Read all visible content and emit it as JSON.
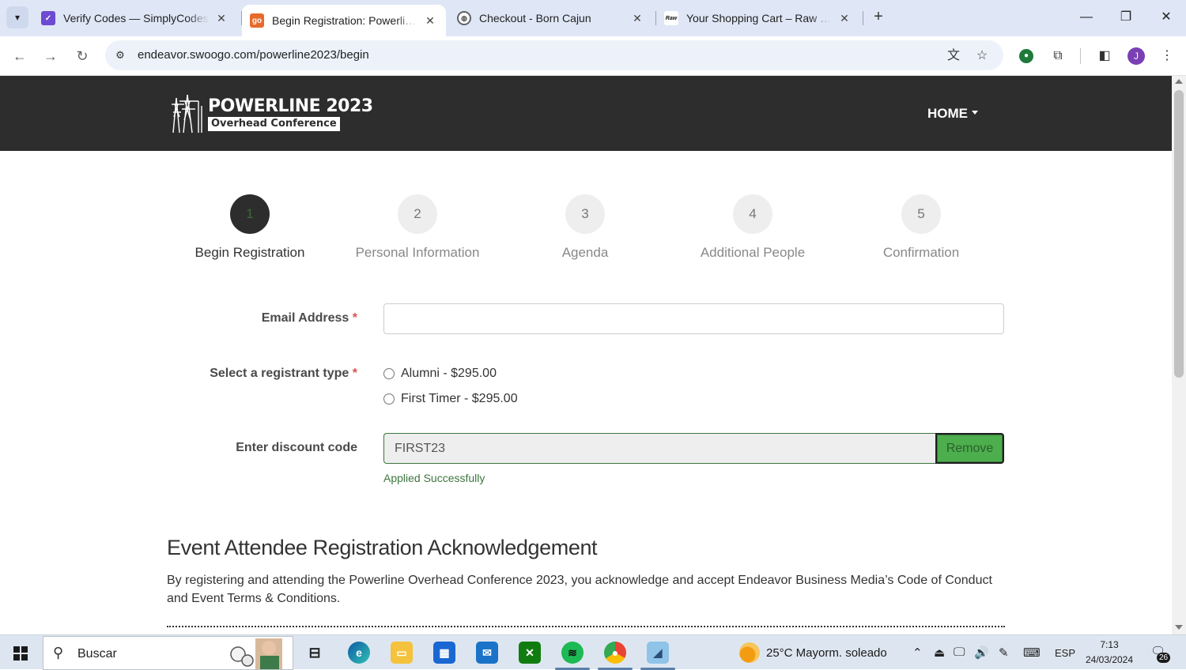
{
  "browser": {
    "tabs": [
      {
        "title": "Verify Codes — SimplyCodes",
        "favicon": "simplycodes-icon",
        "active": false
      },
      {
        "title": "Begin Registration: Powerline Overhead Conference",
        "favicon": "swoogo-icon",
        "active": true
      },
      {
        "title": "Checkout - Born Cajun",
        "favicon": "globe-icon",
        "active": false
      },
      {
        "title": "Your Shopping Cart – Raw Frozen",
        "favicon": "raw-icon",
        "active": false
      }
    ],
    "url": "endeavor.swoogo.com/powerline2023/begin",
    "profile_initial": "J"
  },
  "site": {
    "logo_title": "POWERLINE 2023",
    "logo_subtitle": "Overhead Conference",
    "nav_home": "HOME"
  },
  "steps": [
    {
      "number": "1",
      "label": "Begin Registration",
      "active": true
    },
    {
      "number": "2",
      "label": "Personal Information",
      "active": false
    },
    {
      "number": "3",
      "label": "Agenda",
      "active": false
    },
    {
      "number": "4",
      "label": "Additional People",
      "active": false
    },
    {
      "number": "5",
      "label": "Confirmation",
      "active": false
    }
  ],
  "form": {
    "email_label": "Email Address",
    "email_value": "",
    "registrant_label": "Select a registrant type",
    "registrant_options": [
      "Alumni - $295.00",
      "First Timer - $295.00"
    ],
    "required_marker": "*",
    "discount_label": "Enter discount code",
    "discount_value": "FIRST23",
    "remove_label": "Remove",
    "discount_status": "Applied Successfully"
  },
  "acknowledgement": {
    "title": "Event Attendee Registration Acknowledgement",
    "body": "By registering and attending the Powerline Overhead Conference 2023, you acknowledge and accept Endeavor Business Media’s Code of Conduct and Event Terms & Conditions."
  },
  "taskbar": {
    "search_placeholder": "Buscar",
    "weather": "25°C  Mayorm. soleado",
    "language": "ESP",
    "time": "7:13",
    "date": "24/03/2024",
    "notifications": "26"
  },
  "colors": {
    "header_bg": "#2d2d2d",
    "success_green": "#3c763d",
    "remove_button_bg": "#4cae4c",
    "required_red": "#d9534f"
  }
}
